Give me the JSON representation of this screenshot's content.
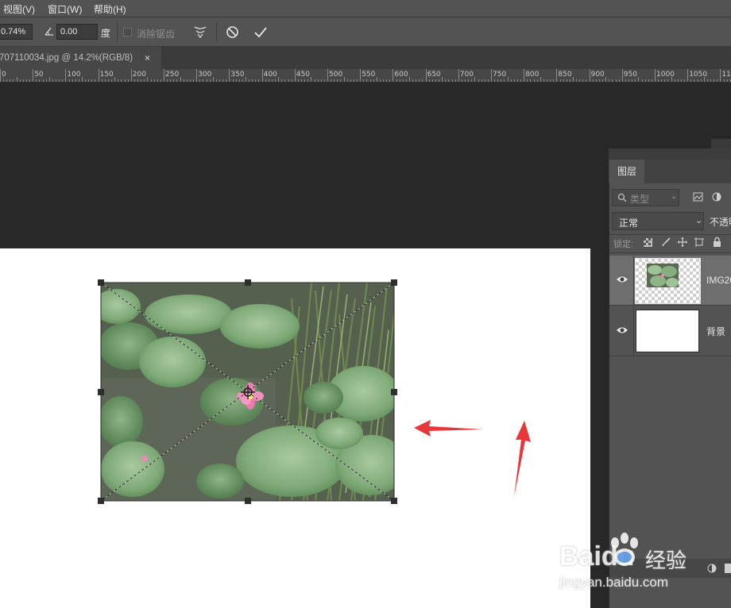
{
  "menu": {
    "items": [
      "视图(V)",
      "窗口(W)",
      "帮助(H)"
    ]
  },
  "options": {
    "scale_value": "0.74%",
    "angle_value": "0.00",
    "angle_unit": "度",
    "antialias_label": "消除锯齿"
  },
  "document_tab": {
    "title": "707110034.jpg @ 14.2%(RGB/8)",
    "close": "×"
  },
  "ruler": {
    "labels": [
      "0",
      "50",
      "100",
      "150",
      "200",
      "250",
      "300",
      "350",
      "400",
      "450",
      "500",
      "550",
      "600",
      "650",
      "700",
      "750",
      "800",
      "850",
      "900",
      "950",
      "1000",
      "1050",
      "11"
    ]
  },
  "layers_panel": {
    "tab_label": "图层",
    "filter_placeholder": "类型",
    "blend_mode": "正常",
    "opacity_label": "不透明",
    "lock_label": "锁定:",
    "layers": [
      {
        "name": "IMG20",
        "selected": true,
        "thumbnail": "photo-transparent"
      },
      {
        "name": "背景",
        "selected": false,
        "thumbnail": "white"
      }
    ]
  },
  "watermark": {
    "brand": "Baidu",
    "brand_cn": "经验",
    "url": "jingyan.baidu.com"
  },
  "colors": {
    "ui_bg": "#535353",
    "workspace": "#282828",
    "arrow": "#e8373a",
    "selected_layer": "#6e6e6e"
  }
}
